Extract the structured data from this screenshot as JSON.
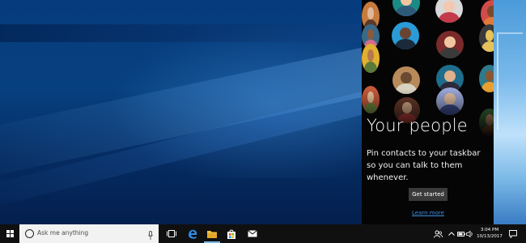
{
  "people_panel": {
    "title": "Your people",
    "subtitle": "Pin contacts to your taskbar so you can talk to them whenever.",
    "get_started_label": "Get started",
    "learn_more_label": "Learn more"
  },
  "taskbar": {
    "search_placeholder": "Ask me anything",
    "icons": [
      "start-icon",
      "task-view-icon",
      "edge-icon",
      "file-explorer-icon",
      "store-icon",
      "mail-icon"
    ],
    "tray_icons": [
      "people-icon",
      "chevron-up-icon",
      "battery-icon",
      "volume-icon",
      "keyboard-icon",
      "action-center-icon"
    ],
    "time": "3:04 PM",
    "date": "10/13/2017",
    "accent_color": "#76b9ed"
  },
  "colors": {
    "desktop": "#063c7e",
    "panel": "#050505",
    "link": "#3e8ddd"
  }
}
